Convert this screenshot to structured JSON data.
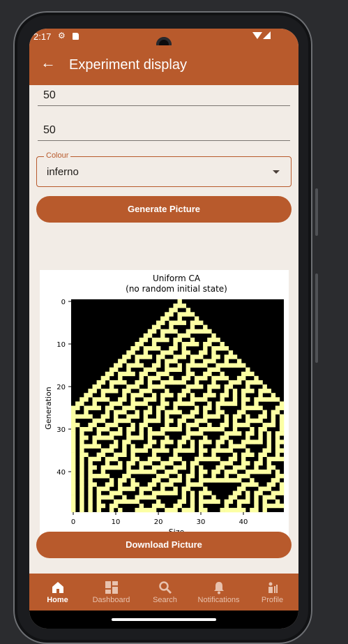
{
  "status_bar": {
    "time": "2:17"
  },
  "app_bar": {
    "title": "Experiment display"
  },
  "form": {
    "field1_value": "50",
    "field2_value": "50",
    "colour_label": "Colour",
    "colour_value": "inferno"
  },
  "buttons": {
    "generate": "Generate Picture",
    "download": "Download Picture"
  },
  "plot": {
    "title_line1": "Uniform CA",
    "title_line2": "(no random initial state)",
    "xlabel": "Size",
    "ylabel": "Generation",
    "xticks": [
      "0",
      "10",
      "20",
      "30",
      "40"
    ],
    "yticks": [
      "0",
      "10",
      "20",
      "30",
      "40"
    ],
    "colors": {
      "background": "#000000",
      "cell": "#fcffa4"
    }
  },
  "chart_data": {
    "type": "heatmap",
    "title": "Uniform CA\n(no random initial state)",
    "xlabel": "Size",
    "ylabel": "Generation",
    "xlim": [
      0,
      50
    ],
    "ylim": [
      0,
      50
    ],
    "colormap": "inferno",
    "rows": 50,
    "cols": 50,
    "rule": "rule 30 from a single seed cell at column 25"
  },
  "nav": [
    {
      "label": "Home",
      "icon": "home-icon",
      "active": true
    },
    {
      "label": "Dashboard",
      "icon": "dashboard-icon",
      "active": false
    },
    {
      "label": "Search",
      "icon": "search-icon",
      "active": false
    },
    {
      "label": "Notifications",
      "icon": "bell-icon",
      "active": false
    },
    {
      "label": "Profile",
      "icon": "profile-icon",
      "active": false
    }
  ]
}
